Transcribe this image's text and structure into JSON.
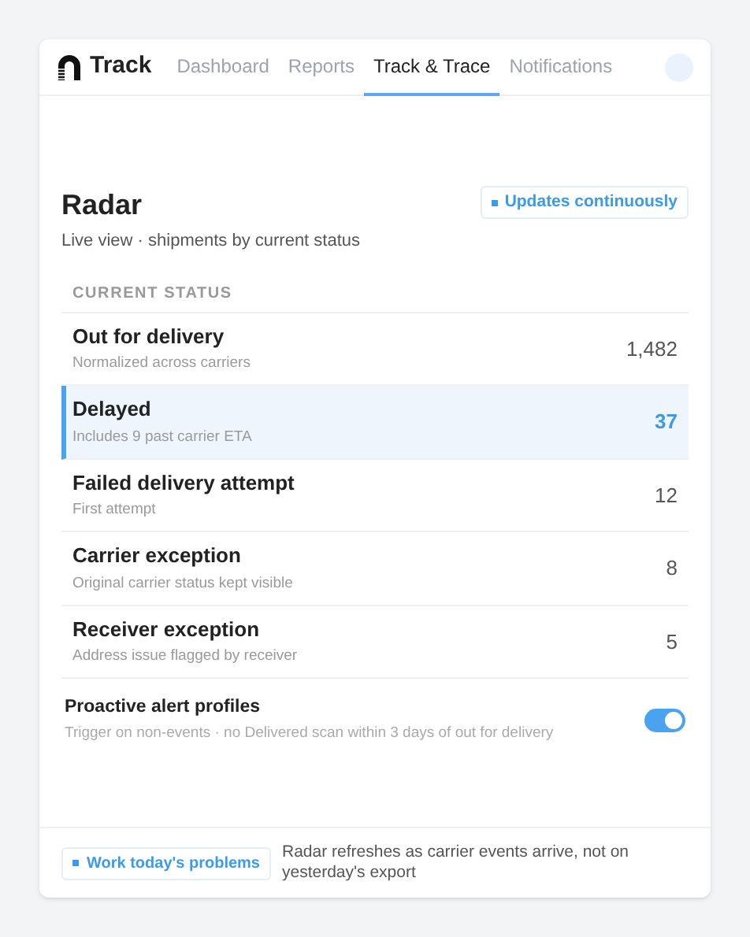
{
  "nav": {
    "brand": "Track",
    "tabs": [
      {
        "label": "Dashboard",
        "selected": false
      },
      {
        "label": "Reports",
        "selected": false
      },
      {
        "label": "Track & Trace",
        "selected": true
      },
      {
        "label": "Notifications",
        "selected": false
      }
    ]
  },
  "header": {
    "title": "Radar",
    "subtitle": "Live view · shipments by current status",
    "badge": "Updates continuously"
  },
  "section_label": "CURRENT STATUS",
  "statuses": [
    {
      "title": "Out for delivery",
      "detail": "Normalized across carriers",
      "count": "1,482",
      "selected": false
    },
    {
      "title": "Delayed",
      "detail": "Includes 9 past carrier ETA",
      "count": "37",
      "selected": true
    },
    {
      "title": "Failed delivery attempt",
      "detail": "First attempt",
      "count": "12",
      "selected": false
    },
    {
      "title": "Carrier exception",
      "detail": "Original carrier status kept visible",
      "count": "8",
      "selected": false
    },
    {
      "title": "Receiver exception",
      "detail": "Address issue flagged by receiver",
      "count": "5",
      "selected": false
    }
  ],
  "alert": {
    "title": "Proactive alert profiles",
    "detail": "Trigger on non-events · no Delivered scan within 3 days of out for delivery",
    "on": true
  },
  "footer": {
    "button": "Work today's problems",
    "note": "Radar refreshes as carrier events arrive, not on yesterday's export"
  }
}
